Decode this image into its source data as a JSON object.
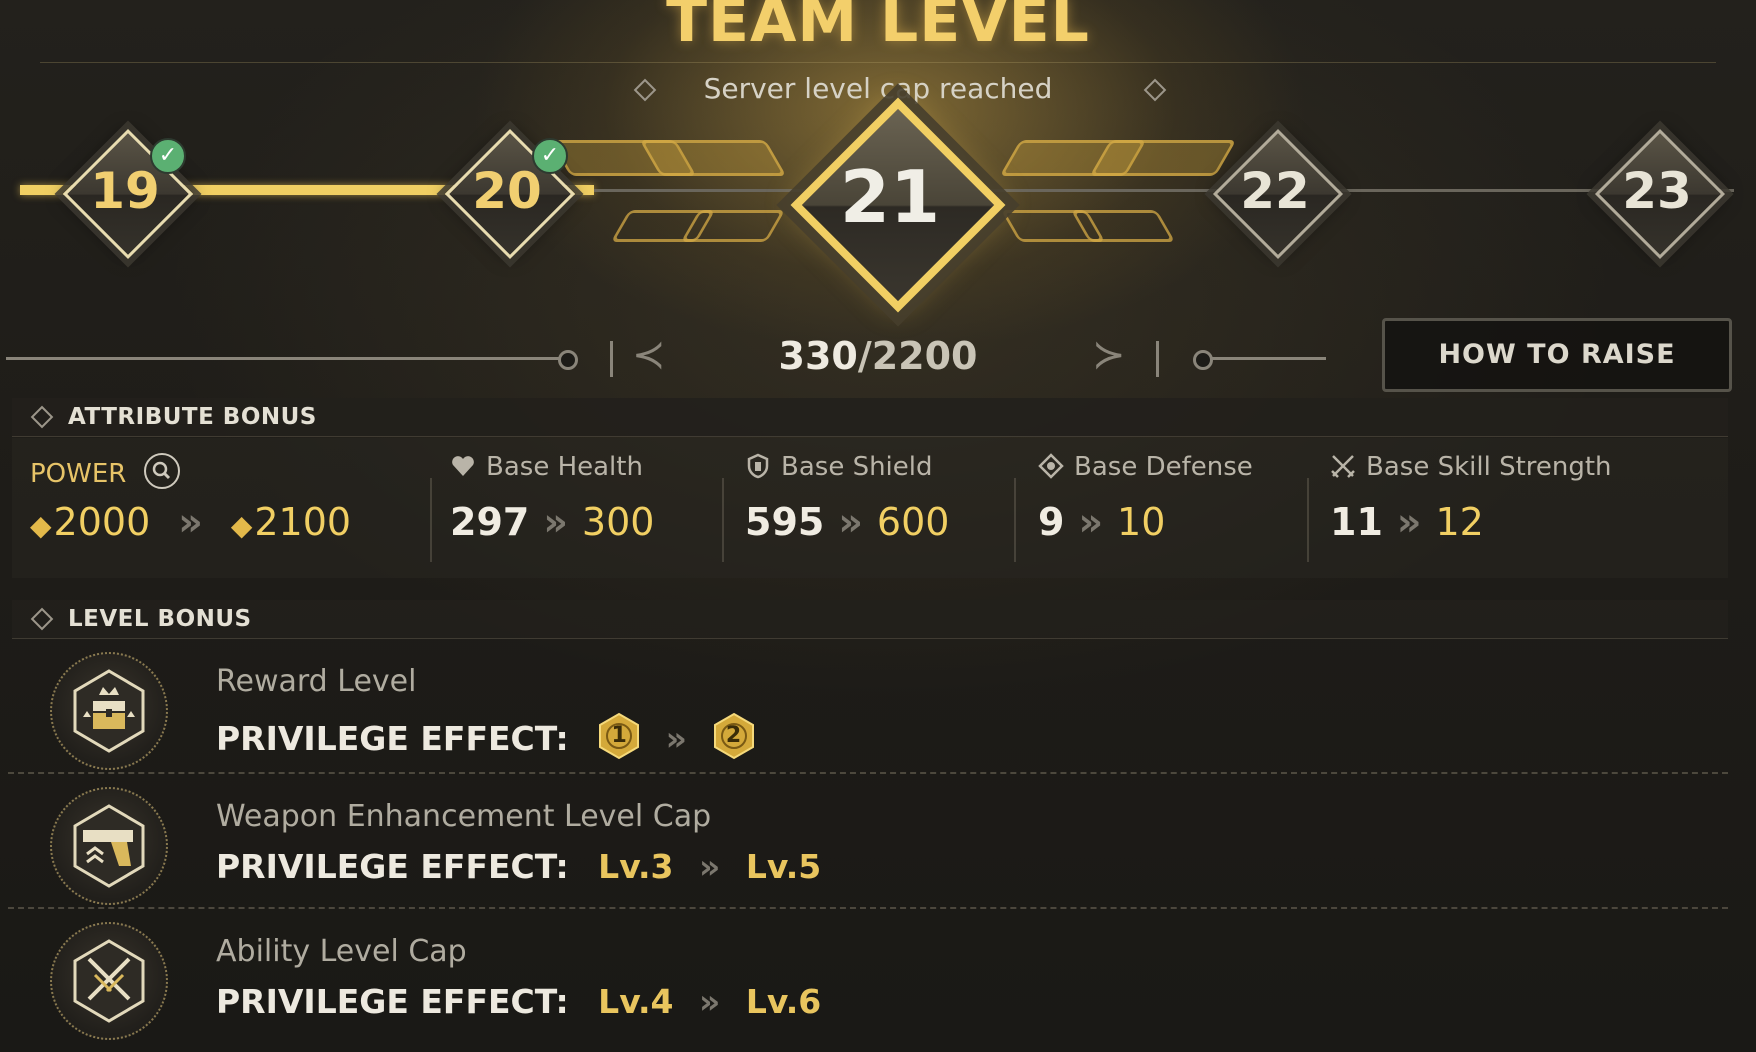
{
  "header": {
    "title": "TEAM LEVEL",
    "subtitle": "Server level cap reached"
  },
  "levels": [
    {
      "label": "19",
      "state": "completed"
    },
    {
      "label": "20",
      "state": "completed"
    },
    {
      "label": "21",
      "state": "current"
    },
    {
      "label": "22",
      "state": "locked"
    },
    {
      "label": "23",
      "state": "locked"
    }
  ],
  "progress": {
    "current": "330",
    "max": "/2200",
    "fraction": 0.15
  },
  "how_to_raise_label": "HOW TO RAISE",
  "attribute_bonus": {
    "header": "ATTRIBUTE BONUS",
    "items": [
      {
        "label": "POWER",
        "icon": "search-icon",
        "from": "2000",
        "to": "2100"
      },
      {
        "label": "Base Health",
        "icon": "heart-icon",
        "from": "297",
        "to": "300"
      },
      {
        "label": "Base Shield",
        "icon": "shield-icon",
        "from": "595",
        "to": "600"
      },
      {
        "label": "Base Defense",
        "icon": "defense-icon",
        "from": "9",
        "to": "10"
      },
      {
        "label": "Base Skill Strength",
        "icon": "crossed-swords-icon",
        "from": "11",
        "to": "12"
      }
    ]
  },
  "level_bonus": {
    "header": "LEVEL BONUS",
    "effect_label": "PRIVILEGE EFFECT:",
    "items": [
      {
        "title": "Reward Level",
        "icon": "treasure-chest-icon",
        "from": "1",
        "to": "2"
      },
      {
        "title": "Weapon Enhancement Level Cap",
        "icon": "pistol-icon",
        "from": "Lv.3",
        "to": "Lv.5"
      },
      {
        "title": "Ability Level Cap",
        "icon": "crossed-swords-icon",
        "from": "Lv.4",
        "to": "Lv.6"
      }
    ]
  },
  "colors": {
    "gold": "#f1cf63",
    "completed_check": "#5bb072",
    "background": "#1b1a17"
  }
}
